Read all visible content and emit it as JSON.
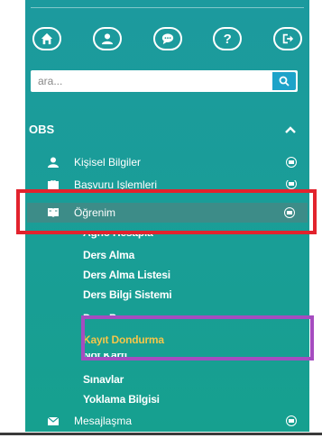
{
  "toolbar": {
    "buttons": [
      {
        "name": "home-icon"
      },
      {
        "name": "user-icon"
      },
      {
        "name": "chat-icon"
      },
      {
        "name": "help-icon",
        "glyph": "?"
      },
      {
        "name": "logout-icon"
      }
    ]
  },
  "search": {
    "placeholder": "ara...",
    "button_icon": "search-icon"
  },
  "section": {
    "title": "OBS",
    "state_icon": "chevron-up-icon"
  },
  "menu": {
    "kisisel": {
      "label": "Kişisel Bilgiler",
      "icon": "user-icon"
    },
    "basvuru": {
      "label": "Başvuru İşlemleri",
      "icon": "briefcase-icon"
    },
    "ogrenim": {
      "label": "Öğrenim",
      "icon": "book-icon"
    },
    "mesajlasma": {
      "label": "Mesajlaşma",
      "icon": "envelope-icon"
    }
  },
  "submenu": [
    "Agno Hesapla",
    "Ders Alma",
    "Ders Alma Listesi",
    "Ders Bilgi Sistemi",
    "Ders Programı",
    "Kayıt Dondurma",
    "Not Kartı",
    "Sınavlar",
    "Yoklama Bilgisi"
  ],
  "colors": {
    "sidebar": "#1a9d98",
    "active_item": "#3d8c88",
    "highlight_text": "#f5c64a",
    "search_button": "#1da3c9",
    "annotation_red": "#e2232d",
    "annotation_purple": "#a54cc0"
  }
}
